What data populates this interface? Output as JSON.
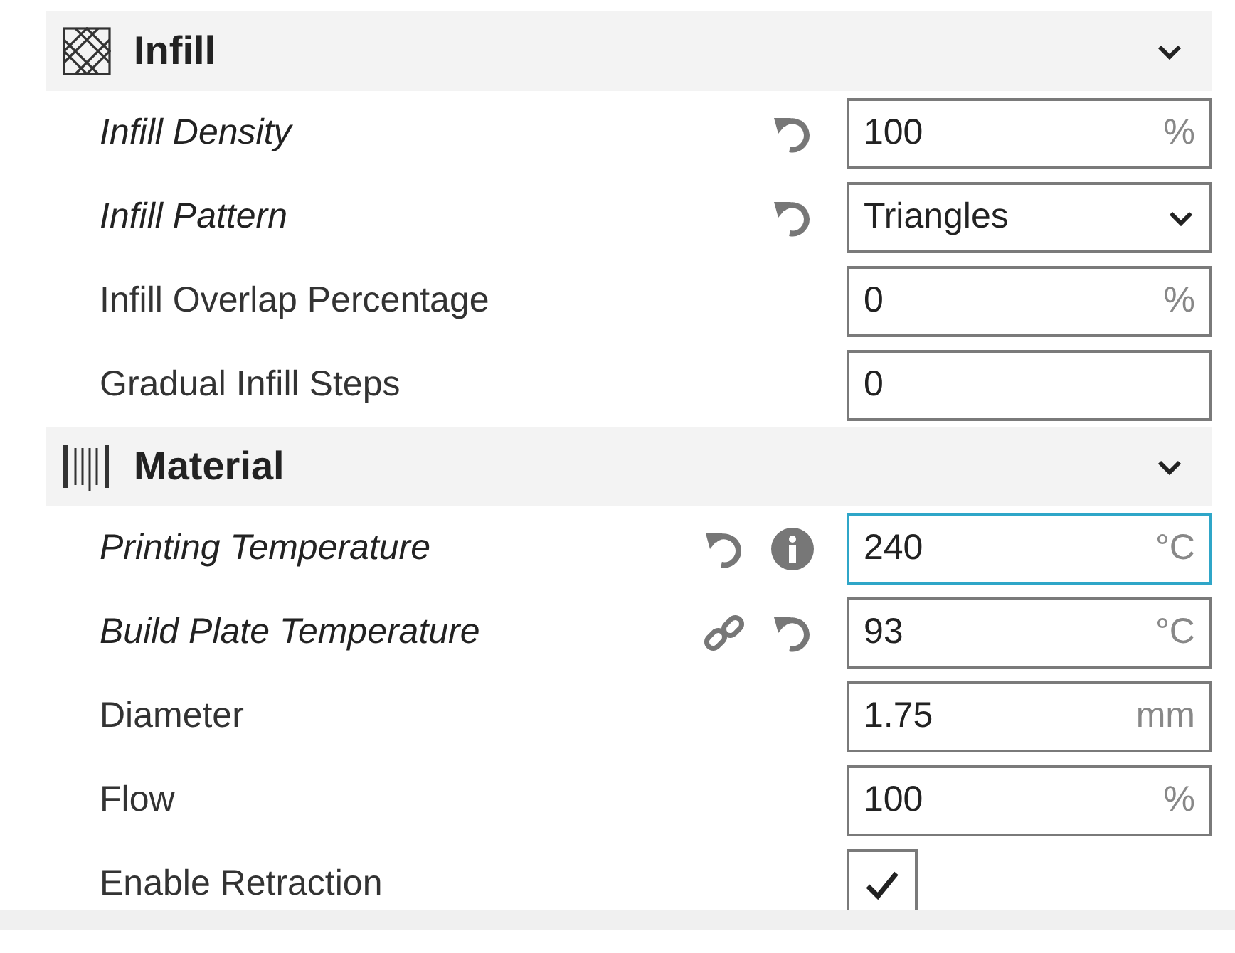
{
  "sections": [
    {
      "title": "Infill",
      "expanded": true,
      "settings": [
        {
          "label": "Infill Density",
          "modified": true,
          "icons": [
            {
              "kind": "reset"
            }
          ],
          "field": {
            "kind": "number",
            "value": "100",
            "unit": "%",
            "focused": false
          }
        },
        {
          "label": "Infill Pattern",
          "modified": true,
          "icons": [
            {
              "kind": "reset"
            }
          ],
          "field": {
            "kind": "dropdown",
            "value": "Triangles",
            "focused": false
          }
        },
        {
          "label": "Infill Overlap Percentage",
          "modified": false,
          "field": {
            "kind": "number",
            "value": "0",
            "unit": "%",
            "focused": false
          }
        },
        {
          "label": "Gradual Infill Steps",
          "modified": false,
          "field": {
            "kind": "number",
            "value": "0",
            "focused": false
          }
        }
      ]
    },
    {
      "title": "Material",
      "expanded": true,
      "settings": [
        {
          "label": "Printing Temperature",
          "modified": true,
          "icons": [
            {
              "kind": "reset"
            },
            {
              "kind": "info"
            }
          ],
          "field": {
            "kind": "number",
            "value": "240",
            "unit": "°C",
            "focused": true
          }
        },
        {
          "label": "Build Plate Temperature",
          "modified": true,
          "icons": [
            {
              "kind": "link"
            },
            {
              "kind": "reset"
            }
          ],
          "field": {
            "kind": "number",
            "value": "93",
            "unit": "°C",
            "focused": false
          }
        },
        {
          "label": "Diameter",
          "modified": false,
          "field": {
            "kind": "number",
            "value": "1.75",
            "unit": "mm",
            "focused": false
          }
        },
        {
          "label": "Flow",
          "modified": false,
          "field": {
            "kind": "number",
            "value": "100",
            "unit": "%",
            "focused": false
          }
        },
        {
          "label": "Enable Retraction",
          "modified": false,
          "field": {
            "kind": "checkbox",
            "checked": true
          }
        }
      ]
    }
  ]
}
